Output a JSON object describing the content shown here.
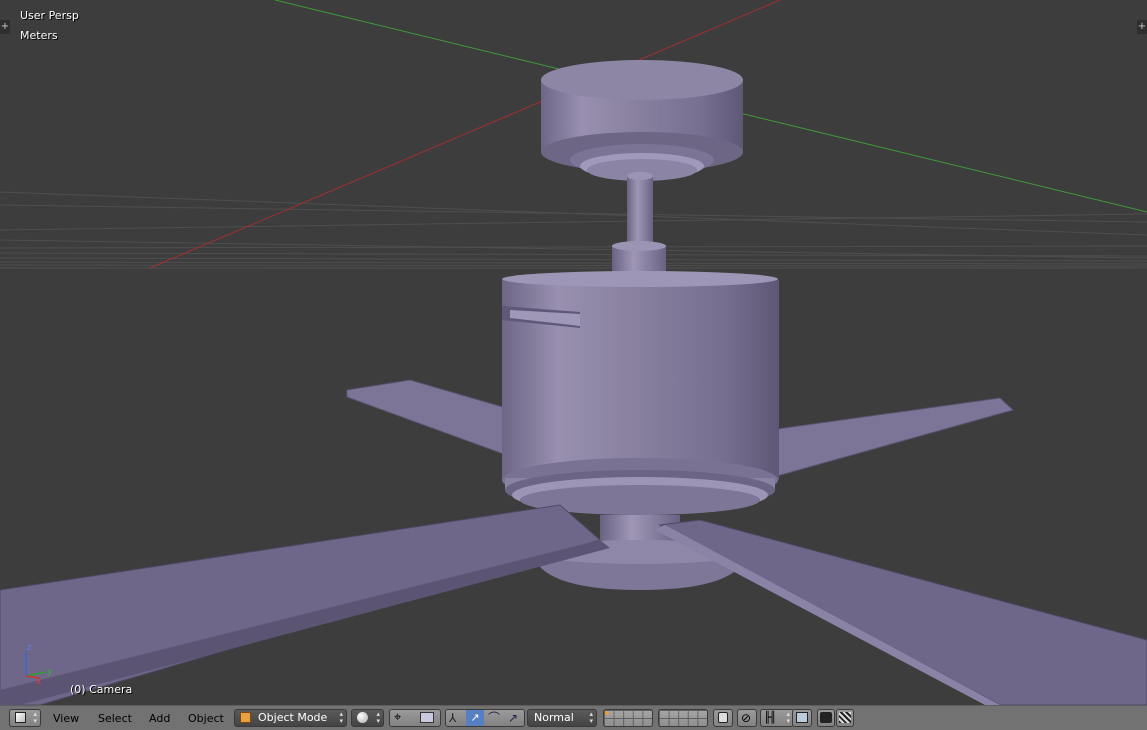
{
  "viewport": {
    "view_name": "User Persp",
    "units": "Meters",
    "object_label": "(0) Camera",
    "axis_x": "x",
    "axis_y": "y",
    "axis_z": "z"
  },
  "header": {
    "menus": [
      "View",
      "Select",
      "Add",
      "Object"
    ],
    "mode": "Object Mode",
    "transform_orientation": "Normal"
  },
  "colors": {
    "background": "#3d3d3d",
    "model": "#8f86a6",
    "x_axis": "#a0302e",
    "y_axis": "#3f9a3a",
    "header": "#727272"
  }
}
